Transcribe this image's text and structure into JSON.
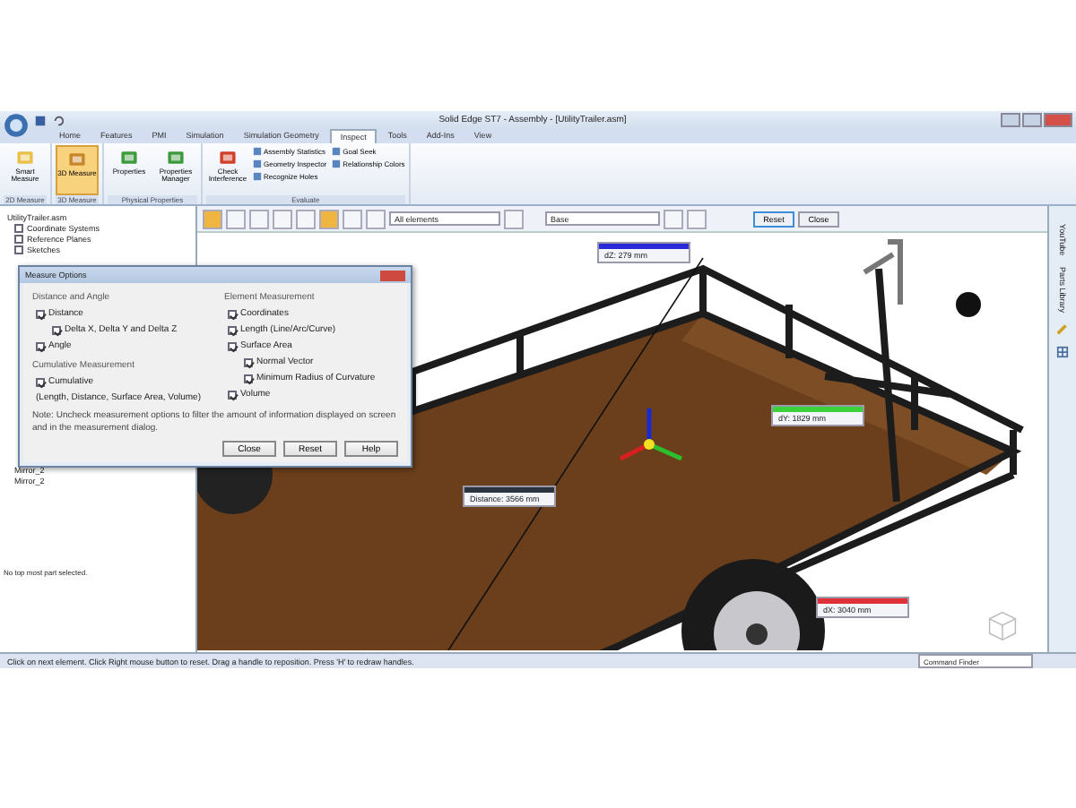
{
  "window": {
    "title": "Solid Edge ST7 - Assembly - [UtilityTrailer.asm]"
  },
  "tabs": [
    {
      "label": "Home",
      "selected": false
    },
    {
      "label": "Features",
      "selected": false
    },
    {
      "label": "PMI",
      "selected": false
    },
    {
      "label": "Simulation",
      "selected": false
    },
    {
      "label": "Simulation Geometry",
      "selected": false
    },
    {
      "label": "Inspect",
      "selected": true
    },
    {
      "label": "Tools",
      "selected": false
    },
    {
      "label": "Add-Ins",
      "selected": false
    },
    {
      "label": "View",
      "selected": false
    }
  ],
  "ribbon_groups": [
    {
      "label": "2D Measure",
      "buttons": [
        {
          "label": "Smart Measure",
          "selected": false
        }
      ]
    },
    {
      "label": "3D Measure",
      "buttons": [
        {
          "label": "3D Measure",
          "selected": true
        }
      ]
    },
    {
      "label": "Physical Properties",
      "buttons": [
        {
          "label": "Properties",
          "selected": false
        },
        {
          "label": "Properties Manager",
          "selected": false
        }
      ]
    },
    {
      "label": "Evaluate",
      "buttons": [
        {
          "label": "Check Interference",
          "selected": false
        }
      ],
      "small_buttons": [
        "Assembly Statistics",
        "Geometry Inspector",
        "Recognize Holes",
        "Goal Seek",
        "Relationship Colors"
      ]
    }
  ],
  "tree": {
    "root": "UtilityTrailer.asm",
    "items": [
      {
        "label": "Coordinate Systems",
        "checked": false
      },
      {
        "label": "Reference Planes",
        "checked": false
      },
      {
        "label": "Sketches",
        "checked": false
      }
    ],
    "lower_items": [
      "Mirror_2",
      "Mirror_2"
    ],
    "message": "No top most part selected."
  },
  "measure_toolbar": {
    "filter": "All elements",
    "coordinate_system": "Base",
    "buttons": [
      "Reset",
      "Close"
    ]
  },
  "measure_options": {
    "title": "Measure Options",
    "sections": [
      {
        "title": "Distance and Angle",
        "options": [
          {
            "label": "Distance",
            "checked": true,
            "children": [
              {
                "label": "Delta X, Delta Y and Delta Z",
                "checked": true
              }
            ]
          },
          {
            "label": "Angle",
            "checked": true
          }
        ]
      },
      {
        "title": "Cumulative Measurement",
        "options": [
          {
            "label": "Cumulative",
            "checked": true,
            "note": "(Length, Distance, Surface Area, Volume)"
          }
        ]
      },
      {
        "title": "Element Measurement",
        "options": [
          {
            "label": "Coordinates",
            "checked": true
          },
          {
            "label": "Length (Line/Arc/Curve)",
            "checked": true
          },
          {
            "label": "Surface Area",
            "checked": true,
            "children": [
              {
                "label": "Normal Vector",
                "checked": true
              },
              {
                "label": "Minimum Radius of Curvature",
                "checked": true
              }
            ]
          },
          {
            "label": "Volume",
            "checked": true
          }
        ]
      }
    ],
    "note": "Note: Uncheck measurement options to filter the amount of information displayed on screen and in the measurement dialog.",
    "buttons": [
      "Close",
      "Reset",
      "Help"
    ]
  },
  "measurements": [
    {
      "label": "dZ: 279 mm",
      "color": "#2a2ad8"
    },
    {
      "label": "dY: 1829 mm",
      "color": "#3cd23c"
    },
    {
      "label": "Distance: 3566 mm",
      "color": "#2c3440"
    },
    {
      "label": "dX: 3040 mm",
      "color": "#e0303a"
    }
  ],
  "side_panel": [
    "YouTube",
    "Parts Library"
  ],
  "status_bar": {
    "prompt": "Click on next element. Click Right mouse button to reset. Drag a handle to reposition. Press 'H' to redraw handles.",
    "command_finder": "Command Finder"
  }
}
